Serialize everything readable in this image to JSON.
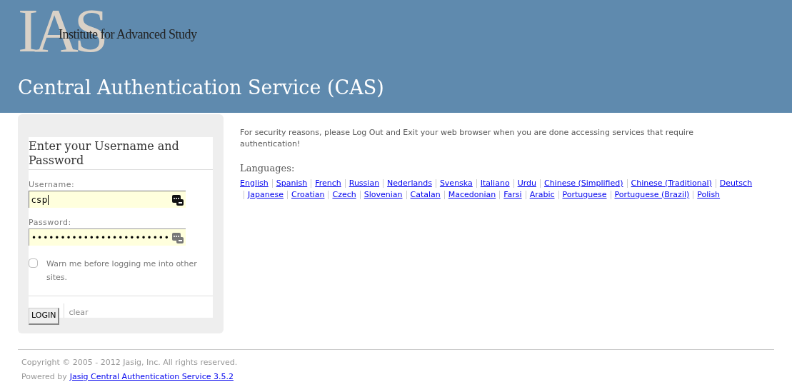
{
  "header": {
    "logo_letters": "IAS",
    "logo_name": "Institute for Advanced Study",
    "title": "Central Authentication Service (CAS)"
  },
  "login": {
    "heading": "Enter your Username and Password",
    "fields": [
      {
        "label": "Username:",
        "value": "csp",
        "focused": true
      },
      {
        "label": "Password:",
        "value": "••••••••••••••••••••••••",
        "focused": false
      }
    ],
    "warn": {
      "label": "Warn me before logging me into other sites.",
      "checked": false
    },
    "buttons": {
      "login": "LOGIN",
      "clear": "clear"
    }
  },
  "notice": "For security reasons, please Log Out and Exit your web browser when you are done accessing services that require authentication!",
  "languages": {
    "heading": "Languages:",
    "items": [
      "English",
      "Spanish",
      "French",
      "Russian",
      "Nederlands",
      "Svenska",
      "Italiano",
      "Urdu",
      "Chinese (Simplified)",
      "Chinese (Traditional)",
      "Deutsch",
      "Japanese",
      "Croatian",
      "Czech",
      "Slovenian",
      "Catalan",
      "Macedonian",
      "Farsi",
      "Arabic",
      "Portuguese",
      "Portuguese (Brazil)",
      "Polish"
    ]
  },
  "footer": {
    "copyright": "Copyright © 2005 - 2012 Jasig, Inc. All rights reserved.",
    "powered_by": "Powered by",
    "link": "Jasig Central Authentication Service 3.5.2"
  }
}
